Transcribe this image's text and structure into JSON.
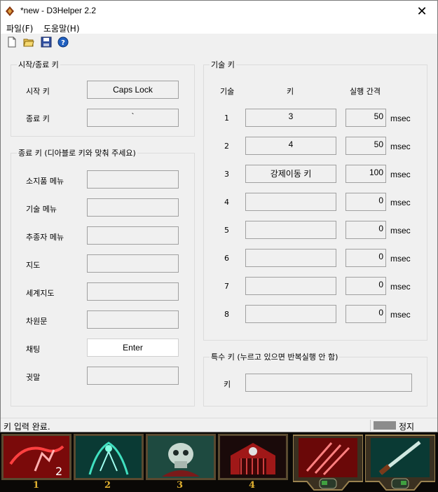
{
  "window": {
    "title": "*new - D3Helper 2.2",
    "close_label": "✕"
  },
  "menu": [
    {
      "label": "파일(F)"
    },
    {
      "label": "도움말(H)"
    }
  ],
  "start_stop": {
    "title": "시작/종료 키",
    "start_label": "시작 키",
    "start_value": "Caps Lock",
    "stop_label": "종료 키",
    "stop_value": "`"
  },
  "end_keys": {
    "title": "종료 키 (디아블로 키와 맞춰 주세요)",
    "rows": [
      {
        "label": "소지품 메뉴",
        "value": ""
      },
      {
        "label": "기술 메뉴",
        "value": ""
      },
      {
        "label": "추종자 메뉴",
        "value": ""
      },
      {
        "label": "지도",
        "value": ""
      },
      {
        "label": "세계지도",
        "value": ""
      },
      {
        "label": "차원문",
        "value": ""
      },
      {
        "label": "채팅",
        "value": "Enter"
      },
      {
        "label": "귓말",
        "value": ""
      }
    ]
  },
  "skill_keys": {
    "title": "기술 키",
    "col_skill": "기술",
    "col_key": "키",
    "col_interval": "실행 간격",
    "unit": "msec",
    "rows": [
      {
        "num": "1",
        "key": "3",
        "interval": "50"
      },
      {
        "num": "2",
        "key": "4",
        "interval": "50"
      },
      {
        "num": "3",
        "key": "강제이동 키",
        "interval": "100"
      },
      {
        "num": "4",
        "key": "",
        "interval": "0"
      },
      {
        "num": "5",
        "key": "",
        "interval": "0"
      },
      {
        "num": "6",
        "key": "",
        "interval": "0"
      },
      {
        "num": "7",
        "key": "",
        "interval": "0"
      },
      {
        "num": "8",
        "key": "",
        "interval": "0"
      }
    ]
  },
  "special_key": {
    "title": "특수 키 (누르고 있으면 반복실행 안 함)",
    "label": "키",
    "value": ""
  },
  "status": {
    "message": "키 입력 완료.",
    "state": "정지",
    "state_color": "#8c8c8c"
  },
  "skillbar": {
    "slots": [
      {
        "num": "1",
        "badge": "2",
        "icon": "sprint-icon"
      },
      {
        "num": "2",
        "icon": "spirit-icon"
      },
      {
        "num": "3",
        "icon": "skull-icon"
      },
      {
        "num": "4",
        "icon": "gate-icon"
      }
    ],
    "mouse_slots": [
      {
        "icon": "claw-icon"
      },
      {
        "icon": "dagger-icon"
      }
    ]
  }
}
